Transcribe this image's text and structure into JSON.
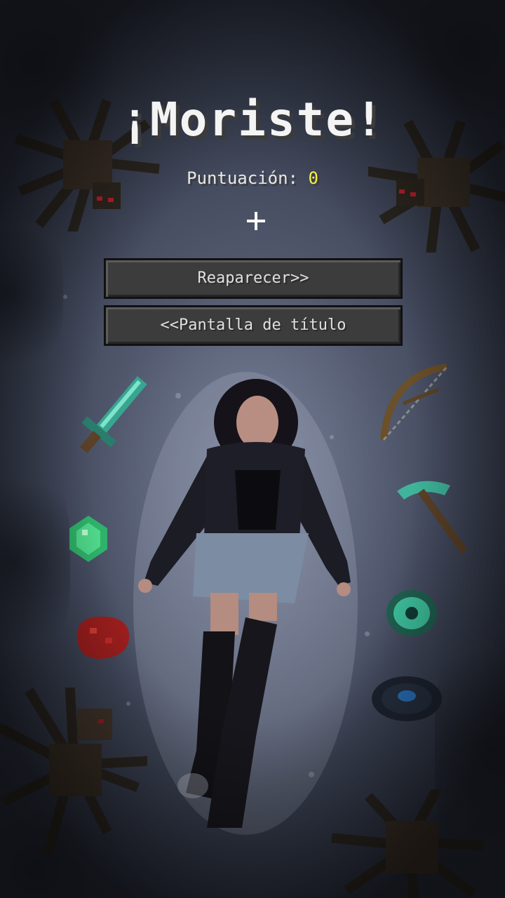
{
  "death_screen": {
    "title": "¡Moriste!",
    "score_label": "Puntuación:",
    "score_value": "0",
    "respawn_label": "Reaparecer>>",
    "title_screen_label": "<<Pantalla de título"
  },
  "scene": {
    "items": [
      {
        "name": "diamond-sword-icon"
      },
      {
        "name": "bow-icon"
      },
      {
        "name": "emerald-icon"
      },
      {
        "name": "diamond-pickaxe-icon"
      },
      {
        "name": "redstone-icon"
      },
      {
        "name": "eye-of-ender-icon"
      },
      {
        "name": "ender-pearl-icon"
      }
    ],
    "mobs": [
      "spider-icon",
      "spider-icon",
      "spider-icon",
      "spider-icon"
    ]
  },
  "colors": {
    "score_value": "#f6f04a",
    "button_fill": "#3c3c3c",
    "title_text": "#f4f4f4"
  }
}
